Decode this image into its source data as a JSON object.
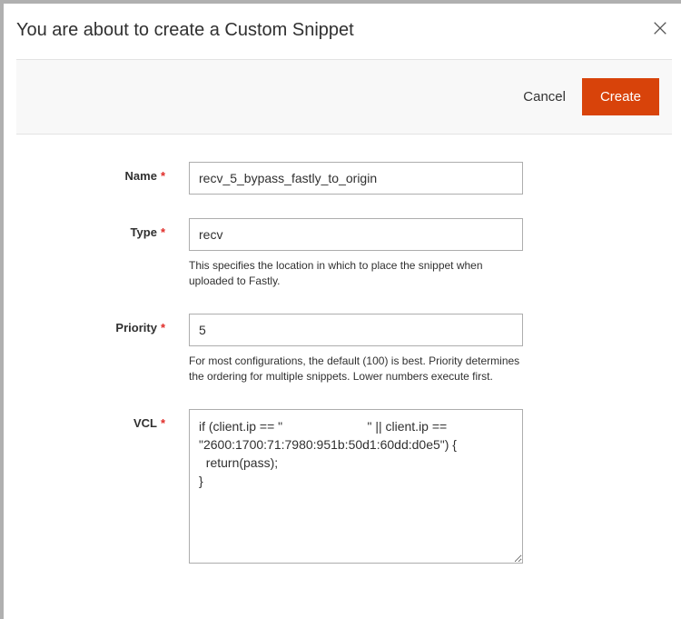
{
  "header": {
    "title": "You are about to create a Custom Snippet"
  },
  "actions": {
    "cancel": "Cancel",
    "create": "Create"
  },
  "form": {
    "name": {
      "label": "Name",
      "value": "recv_5_bypass_fastly_to_origin"
    },
    "type": {
      "label": "Type",
      "value": "recv",
      "help": "This specifies the location in which to place the snippet when uploaded to Fastly."
    },
    "priority": {
      "label": "Priority",
      "value": "5",
      "help": "For most configurations, the default (100) is best. Priority determines the ordering for multiple snippets. Lower numbers execute first."
    },
    "vcl": {
      "label": "VCL",
      "value": "if (client.ip == \"                        \" || client.ip == \"2600:1700:71:7980:951b:50d1:60dd:d0e5\") {\n  return(pass);\n}"
    }
  }
}
